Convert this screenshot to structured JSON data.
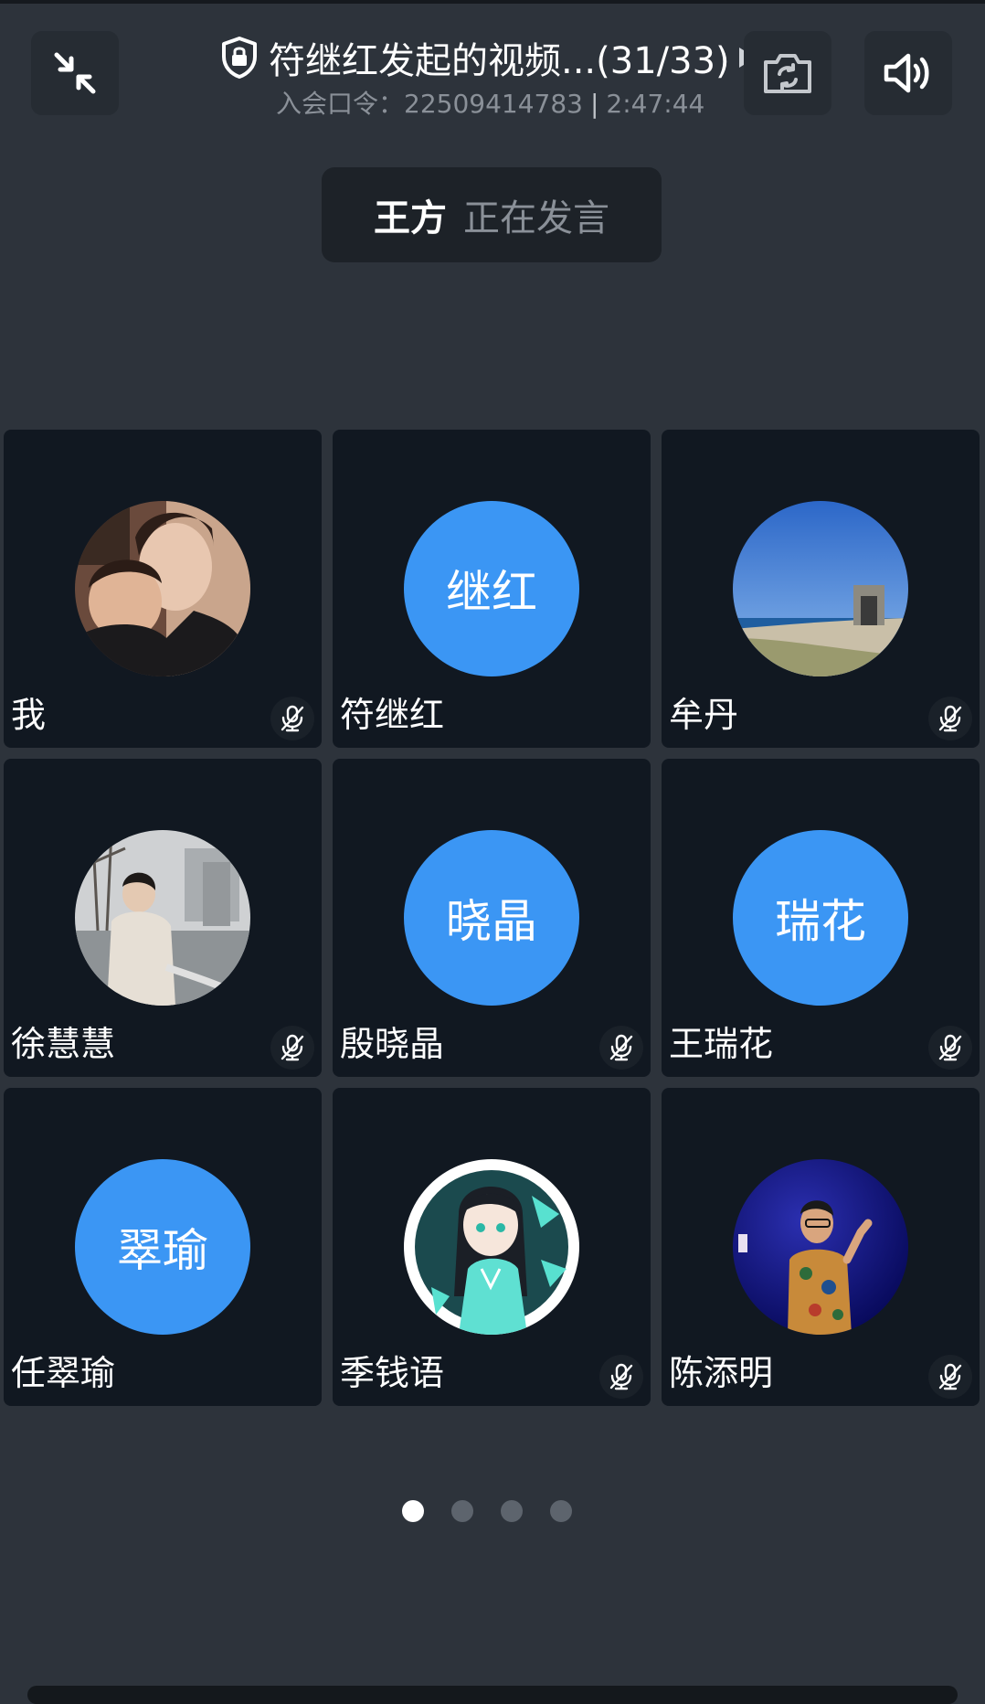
{
  "header": {
    "title": "符继红发起的视频...(31/33)",
    "passcode_label": "入会口令：22509414783",
    "duration": "2:47:44"
  },
  "speaker": {
    "name": "王方",
    "status": "正在发言"
  },
  "participants": [
    {
      "name": "我",
      "avatar_text": "",
      "avatar_type": "photo-mother-child",
      "muted": true
    },
    {
      "name": "符继红",
      "avatar_text": "继红",
      "avatar_type": "text",
      "muted": false
    },
    {
      "name": "牟丹",
      "avatar_text": "",
      "avatar_type": "photo-seaside",
      "muted": true
    },
    {
      "name": "徐慧慧",
      "avatar_text": "",
      "avatar_type": "photo-riverside",
      "muted": true
    },
    {
      "name": "殷晓晶",
      "avatar_text": "晓晶",
      "avatar_type": "text",
      "muted": true
    },
    {
      "name": "王瑞花",
      "avatar_text": "瑞花",
      "avatar_type": "text",
      "muted": true
    },
    {
      "name": "任翠瑜",
      "avatar_text": "翠瑜",
      "avatar_type": "text",
      "muted": false
    },
    {
      "name": "季钱语",
      "avatar_text": "",
      "avatar_type": "illustration-girl",
      "muted": true
    },
    {
      "name": "陈添明",
      "avatar_text": "",
      "avatar_type": "photo-stage-singer",
      "muted": true
    }
  ],
  "icons": {
    "minimize": "collapse-arrows-icon",
    "secure": "lock-shield-icon",
    "camera": "camera-switch-icon",
    "speaker": "speaker-volume-icon",
    "muted": "mic-off-icon"
  },
  "colors": {
    "background": "#2d333b",
    "tile": "#111821",
    "avatar_blue": "#3b96f4"
  },
  "pagination": {
    "pages": 4,
    "current": 1
  }
}
